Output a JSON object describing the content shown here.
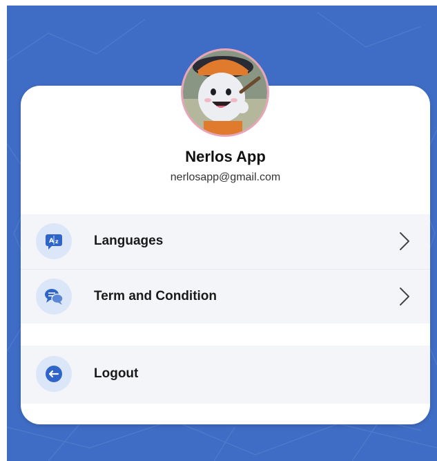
{
  "profile": {
    "name": "Nerlos App",
    "email": "nerlosapp@gmail.com"
  },
  "menu": {
    "items": [
      {
        "label": "Languages",
        "icon": "translate-icon"
      },
      {
        "label": "Term and Condition",
        "icon": "chat-bubbles-icon"
      }
    ],
    "logout": {
      "label": "Logout",
      "icon": "logout-icon"
    }
  },
  "colors": {
    "background": "#3f6cc4",
    "card": "#ffffff",
    "icon_bg": "#dbe6f8",
    "icon_fg": "#2f65c8",
    "row_bg": "#f4f5f9"
  }
}
